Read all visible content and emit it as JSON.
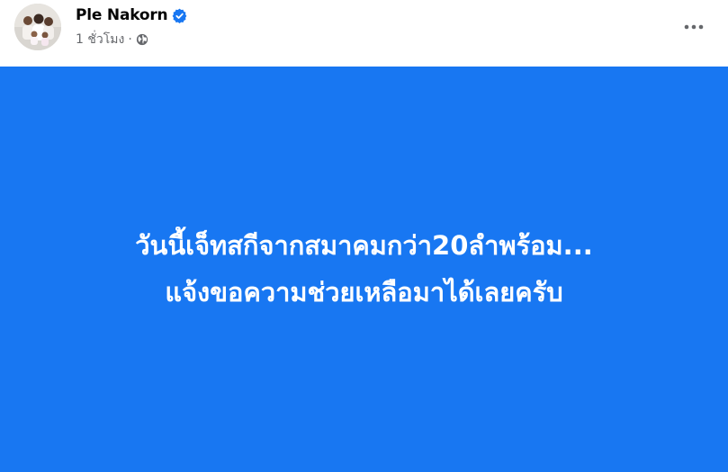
{
  "post": {
    "author": {
      "name": "Ple Nakorn",
      "verified": true,
      "avatar_icon": "family-photo-avatar"
    },
    "meta": {
      "time": "1 ชั่วโมง",
      "separator": "·",
      "audience_icon": "globe-icon"
    },
    "more_icon": "more-options-icon",
    "content": {
      "background_color": "#1877f2",
      "text_color": "#ffffff",
      "lines": [
        "วันนี้เจ็ทสกีจากสมาคมกว่า20ลำพร้อม...",
        "แจ้งขอความช่วยเหลือมาได้เลยครับ"
      ]
    }
  },
  "colors": {
    "verified_badge": "#1877f2",
    "name_text": "#050505",
    "meta_text": "#65676b"
  }
}
